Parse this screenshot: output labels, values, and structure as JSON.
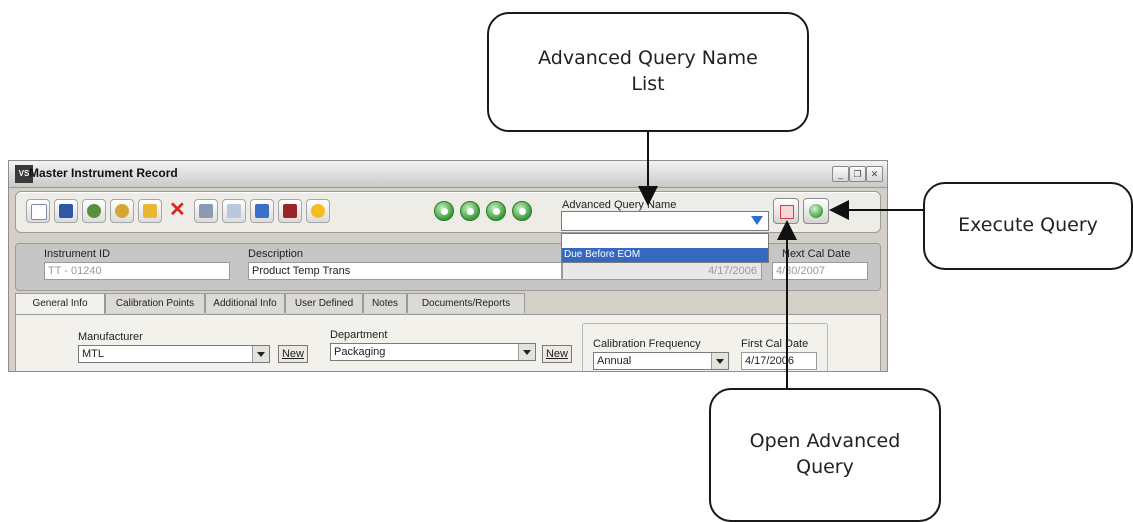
{
  "callouts": {
    "query_name_list": "Advanced Query Name List",
    "execute_query": "Execute Query",
    "open_advanced_query": "Open Advanced Query"
  },
  "window": {
    "title": "Master Instrument Record",
    "app_icon_text": "VS",
    "toolbar_icons": [
      "new-icon",
      "save-icon",
      "refresh-icon",
      "search-icon",
      "folder-icon",
      "delete-icon",
      "print-icon",
      "preview-icon",
      "edit-icon",
      "exit-icon",
      "help-icon"
    ],
    "nav_icons": [
      "first-record-icon",
      "previous-record-icon",
      "next-record-icon",
      "last-record-icon"
    ],
    "advanced_query": {
      "label": "Advanced Query Name",
      "value": "",
      "options": [
        "",
        "Due Before EOM"
      ],
      "selected_option": "Due Before EOM"
    }
  },
  "header": {
    "instrument_id_label": "Instrument ID",
    "instrument_id": "TT - 01240",
    "description_label": "Description",
    "description": "Product Temp Trans",
    "last_cal_date": "4/17/2006",
    "next_cal_date_label": "Next Cal Date",
    "next_cal_date": "4/30/2007"
  },
  "tabs": [
    "General Info",
    "Calibration Points",
    "Additional Info",
    "User Defined",
    "Notes",
    "Documents/Reports"
  ],
  "general": {
    "manufacturer_label": "Manufacturer",
    "manufacturer": "MTL",
    "department_label": "Department",
    "department": "Packaging",
    "new_label": "New",
    "cal_frequency_label": "Calibration Frequency",
    "cal_frequency": "Annual",
    "first_cal_date_label": "First Cal Date",
    "first_cal_date": "4/17/2006"
  }
}
